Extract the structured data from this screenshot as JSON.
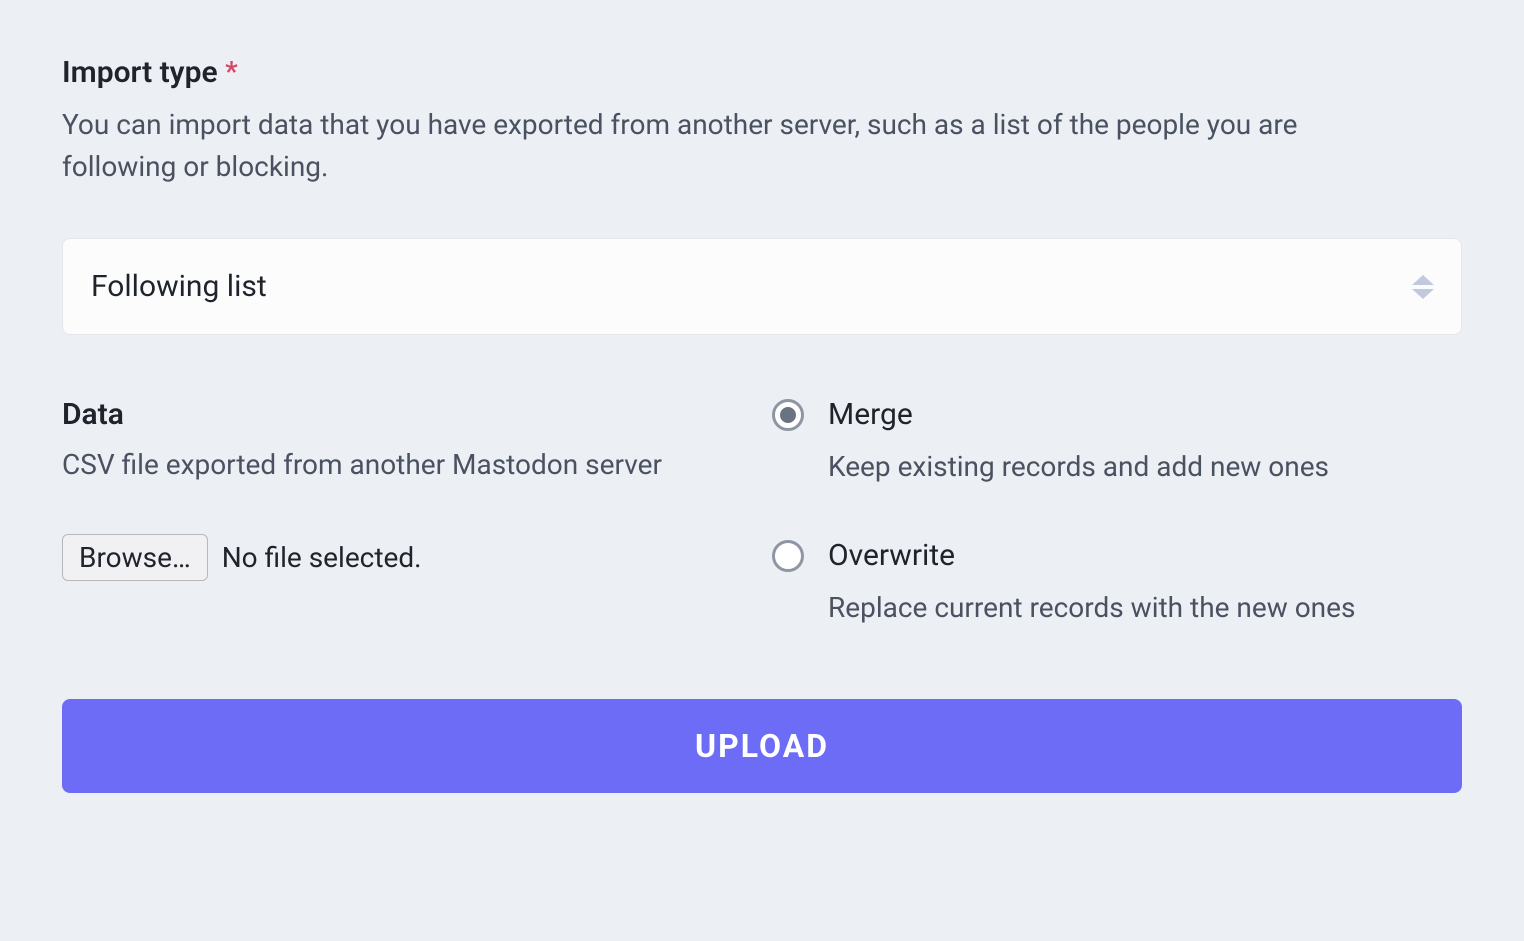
{
  "importType": {
    "label": "Import type",
    "required": "*",
    "description": "You can import data that you have exported from another server, such as a list of the people you are following or blocking.",
    "selected": "Following list"
  },
  "data": {
    "label": "Data",
    "description": "CSV file exported from another Mastodon server",
    "browseLabel": "Browse…",
    "noFileText": "No file selected."
  },
  "modes": {
    "merge": {
      "title": "Merge",
      "description": "Keep existing records and add new ones",
      "selected": true
    },
    "overwrite": {
      "title": "Overwrite",
      "description": "Replace current records with the new ones",
      "selected": false
    }
  },
  "uploadButton": "UPLOAD"
}
